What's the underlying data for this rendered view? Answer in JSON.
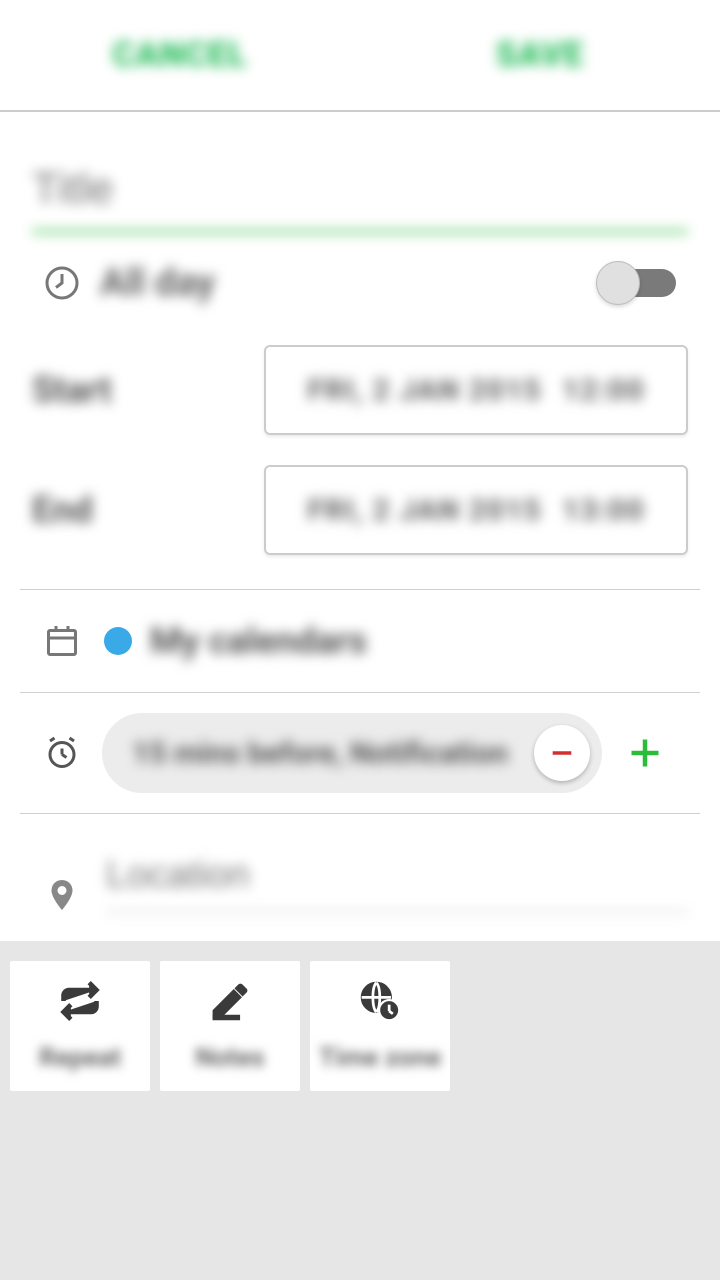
{
  "header": {
    "cancel": "CANCEL",
    "save": "SAVE"
  },
  "title_placeholder": "Title",
  "allday_label": "All day",
  "start_label": "Start",
  "end_label": "End",
  "start_date": "FRI, 2 JAN 2015",
  "start_time": "12:00",
  "end_date": "FRI, 2 JAN 2015",
  "end_time": "13:00",
  "calendar": {
    "name": "My calendars",
    "color": "#3aa9e8"
  },
  "reminder": "15 mins before, Notification",
  "location_placeholder": "Location",
  "bottom": {
    "repeat": "Repeat",
    "notes": "Notes",
    "timezone": "Time zone"
  },
  "accent": "#1db954"
}
